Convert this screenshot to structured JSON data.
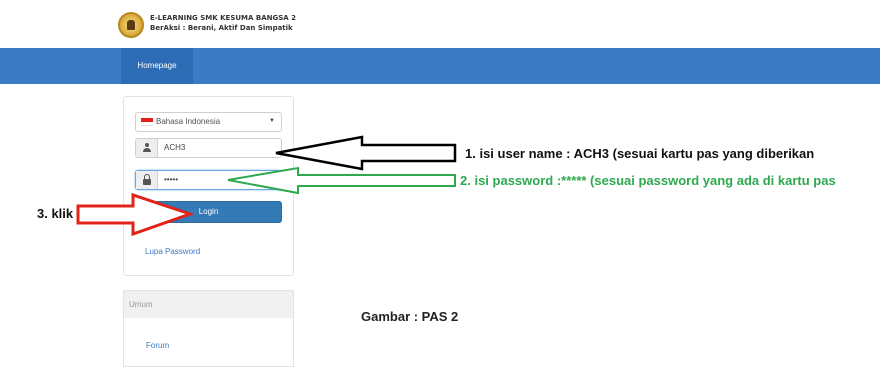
{
  "header": {
    "site_name": "E-LEARNING SMK KESUMA BANGSA 2",
    "tagline": "BerAksi : Berani, Aktif Dan Simpatik"
  },
  "nav": {
    "home_label": "Homepage"
  },
  "login": {
    "language": "Bahasa Indonesia",
    "username": "ACH3",
    "password_masked": "•••••",
    "login_label": "Login",
    "forgot_label": "Lupa Password"
  },
  "sidebar": {
    "section_title": "Umum",
    "items": [
      {
        "label": "Forum"
      }
    ]
  },
  "annotations": {
    "step1": "1. isi user name : ACH3 (sesuai kartu pas yang diberikan",
    "step2": "2. isi password :***** (sesuai password yang ada di kartu pas",
    "step3": "3. klik",
    "caption": "Gambar : PAS 2"
  },
  "colors": {
    "navbar": "#3a7bc4",
    "button": "#337ab7",
    "arrow_black": "#000000",
    "arrow_green": "#2fa84f",
    "arrow_red": "#e2231a"
  }
}
